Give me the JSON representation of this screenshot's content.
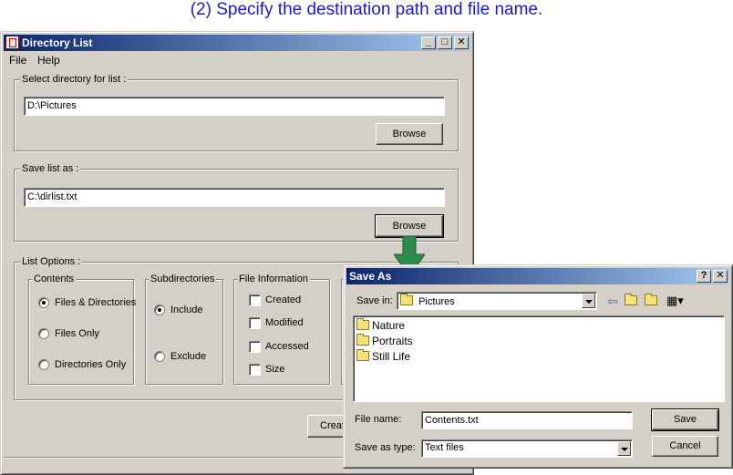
{
  "caption": "(2) Specify the destination path and file name.",
  "main_window": {
    "title": "Directory List",
    "menu": [
      "File",
      "Help"
    ],
    "select_group_label": "Select directory for list :",
    "select_dir_value": "D:\\Pictures",
    "browse_label_1": "Browse",
    "save_group_label": "Save list as :",
    "save_path_value": "C:\\dirlist.txt",
    "browse_label_2": "Browse",
    "options_label": "List Options :",
    "contents": {
      "label": "Contents",
      "items": [
        "Files & Directories",
        "Files Only",
        "Directories Only"
      ],
      "selected": "Files & Directories"
    },
    "subdirectories": {
      "label": "Subdirectories",
      "items": [
        "Include",
        "Exclude"
      ],
      "selected": "Include"
    },
    "file_information": {
      "label": "File Information",
      "items": [
        "Created",
        "Modified",
        "Accessed",
        "Size"
      ]
    },
    "create_button_partial": "Creat"
  },
  "save_as": {
    "title": "Save As",
    "save_in_label": "Save in:",
    "save_in_value": "Pictures",
    "folders": [
      "Nature",
      "Portraits",
      "Still Life"
    ],
    "file_name_label": "File name:",
    "file_name_value": "Contents.txt",
    "save_type_label": "Save as type:",
    "save_type_value": "Text files",
    "save_button": "Save",
    "cancel_button": "Cancel",
    "help_glyph": "?",
    "close_glyph": "✕"
  },
  "colors": {
    "caption": "#1a1acd",
    "title_start": "#0a246a",
    "arrow": "#2e8b4e"
  }
}
